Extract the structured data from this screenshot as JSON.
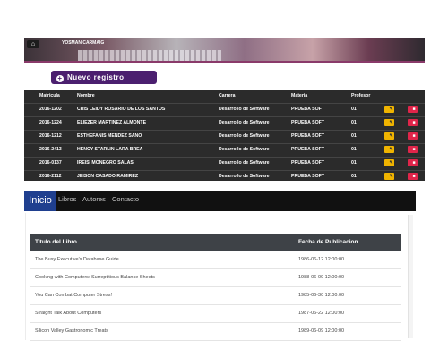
{
  "registry": {
    "banner_user": "YOSMAN  CARMAIG",
    "new_button": "Nuevo registro",
    "columns": [
      "Matricula",
      "Nombre",
      "Carrera",
      "Materia",
      "Profesor"
    ],
    "rows": [
      {
        "matricula": "2016-1202",
        "nombre": "CRIS LEIDY ROSARIO DE LOS SANTOS",
        "carrera": "Desarrollo de Software",
        "materia": "PRUEBA SOFT",
        "profesor": "01"
      },
      {
        "matricula": "2016-1224",
        "nombre": "ELIEZER MARTINEZ ALMONTE",
        "carrera": "Desarrollo de Software",
        "materia": "PRUEBA SOFT",
        "profesor": "01"
      },
      {
        "matricula": "2016-1212",
        "nombre": "ESTHEFANIS MENDEZ SANO",
        "carrera": "Desarrollo de Software",
        "materia": "PRUEBA SOFT",
        "profesor": "01"
      },
      {
        "matricula": "2016-2413",
        "nombre": "HENCY STARLIN LARA BREA",
        "carrera": "Desarrollo de Software",
        "materia": "PRUEBA SOFT",
        "profesor": "01"
      },
      {
        "matricula": "2016-0137",
        "nombre": "IREISI MONEGRO SALAS",
        "carrera": "Desarrollo de Software",
        "materia": "PRUEBA SOFT",
        "profesor": "01"
      },
      {
        "matricula": "2016-2112",
        "nombre": "JEISON CASADO RAMIREZ",
        "carrera": "Desarrollo de Software",
        "materia": "PRUEBA SOFT",
        "profesor": "01"
      }
    ],
    "edit_icon": "edit-icon",
    "delete_icon": "trash-icon",
    "colors": {
      "edit": "#f0b400",
      "delete": "#e0254a",
      "new": "#4b1f6f"
    }
  },
  "navbar": {
    "brand": "Inicio",
    "links": [
      "Libros",
      "Autores",
      "Contacto"
    ]
  },
  "books": {
    "columns": [
      "Titulo del Libro",
      "Fecha de Publicacion"
    ],
    "rows": [
      {
        "title": "The Busy Executive's Database Guide",
        "date": "1986-06-12 12:00:00"
      },
      {
        "title": "Cooking with Computers: Surreptitious Balance Sheets",
        "date": "1988-06-09 12:00:00"
      },
      {
        "title": "You Can Combat Computer Stress!",
        "date": "1985-06-30 12:00:00"
      },
      {
        "title": "Straight Talk About Computers",
        "date": "1987-06-22 12:00:00"
      },
      {
        "title": "Silicon Valley Gastronomic Treats",
        "date": "1989-06-09 12:00:00"
      }
    ]
  }
}
